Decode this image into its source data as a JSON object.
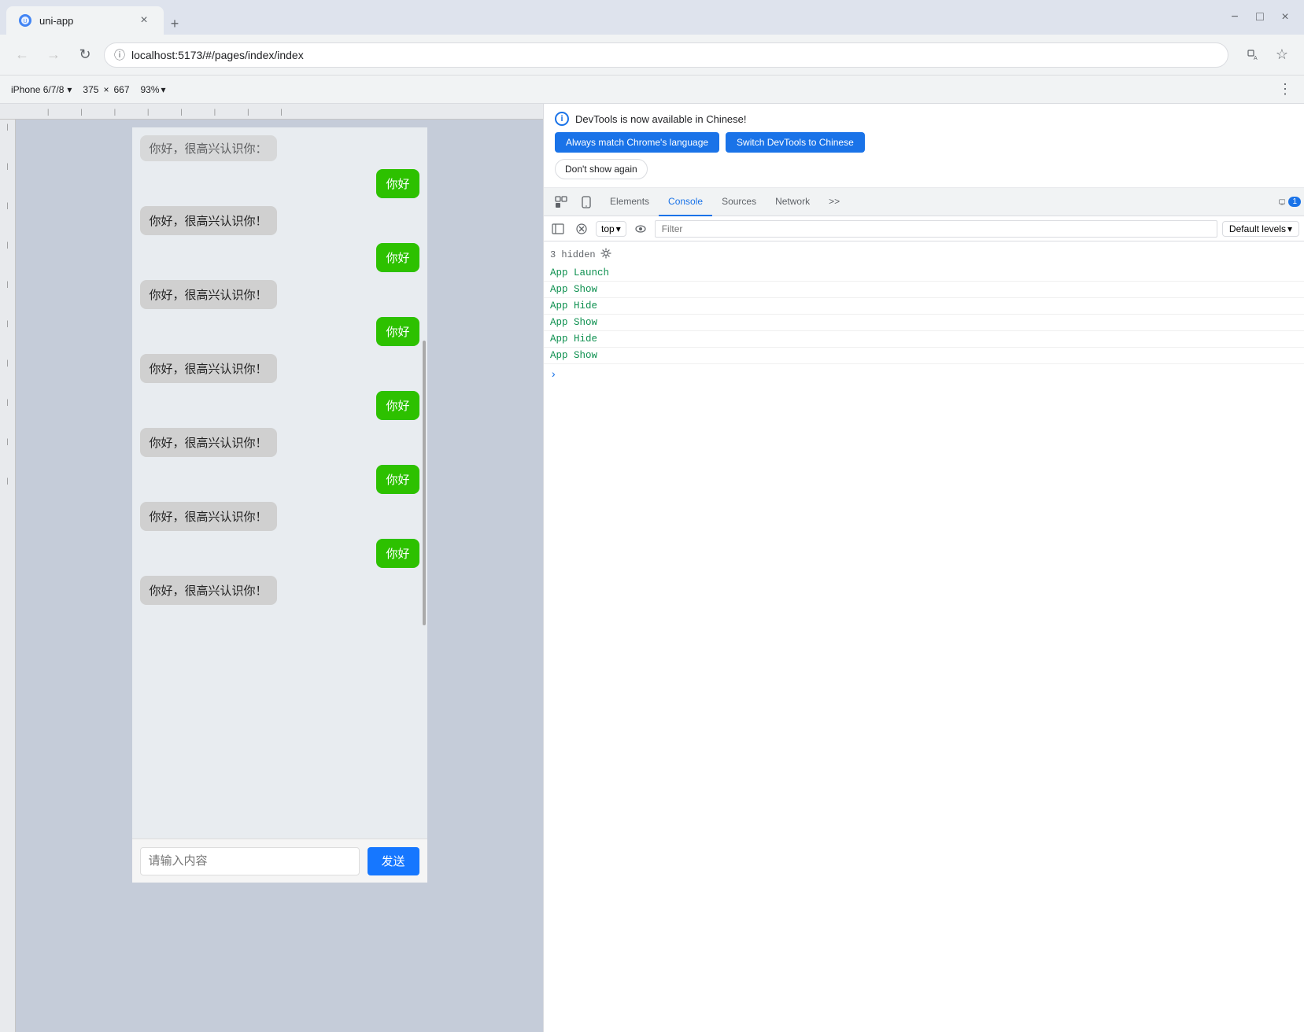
{
  "browser": {
    "tab": {
      "title": "uni-app",
      "favicon": "U"
    },
    "new_tab_label": "+",
    "window_controls": {
      "minimize": "−",
      "maximize": "□",
      "close": "×"
    },
    "address": "localhost:5173/#/pages/index/index",
    "nav": {
      "back_disabled": true,
      "forward_disabled": true,
      "reload": "↻"
    },
    "translate_icon": "T",
    "bookmark_icon": "☆"
  },
  "toolbar": {
    "device": "iPhone 6/7/8",
    "device_arrow": "▾",
    "width": "375",
    "x": "×",
    "height": "667",
    "zoom": "93%",
    "zoom_arrow": "▾",
    "more": "⋮"
  },
  "chat": {
    "messages": [
      {
        "type": "left",
        "text": "你好，很高兴认识你！",
        "truncated": true
      },
      {
        "type": "right",
        "text": "你好"
      },
      {
        "type": "left",
        "text": "你好，很高兴认识你！"
      },
      {
        "type": "right",
        "text": "你好"
      },
      {
        "type": "left",
        "text": "你好，很高兴认识你！"
      },
      {
        "type": "right",
        "text": "你好"
      },
      {
        "type": "left",
        "text": "你好，很高兴认识你！"
      },
      {
        "type": "right",
        "text": "你好"
      },
      {
        "type": "left",
        "text": "你好，很高兴认识你！"
      },
      {
        "type": "right",
        "text": "你好"
      },
      {
        "type": "left",
        "text": "你好，很高兴认识你！"
      },
      {
        "type": "right",
        "text": "你好"
      },
      {
        "type": "left",
        "text": "你好，很高兴认识你！"
      }
    ],
    "input_placeholder": "请输入内容",
    "send_button": "发送"
  },
  "devtools": {
    "banner": {
      "info_text": "DevTools is now available in Chinese!",
      "btn1": "Always match Chrome's language",
      "btn2": "Switch DevTools to Chinese",
      "btn3": "Don't show again"
    },
    "tabs": [
      {
        "label": "Elements",
        "active": false
      },
      {
        "label": "Console",
        "active": true
      },
      {
        "label": "Sources",
        "active": false
      },
      {
        "label": "Network",
        "active": false
      },
      {
        "label": ">>",
        "active": false
      }
    ],
    "tab_badge": "1",
    "console_toolbar": {
      "top_label": "top",
      "filter_placeholder": "Filter",
      "levels_label": "Default levels",
      "levels_arrow": "▾"
    },
    "console": {
      "hidden_count": "3 hidden",
      "entries": [
        {
          "text": "App Launch"
        },
        {
          "text": "App Show"
        },
        {
          "text": "App Hide"
        },
        {
          "text": "App Show"
        },
        {
          "text": "App Hide"
        },
        {
          "text": "App Show"
        }
      ],
      "prompt": ">"
    }
  }
}
